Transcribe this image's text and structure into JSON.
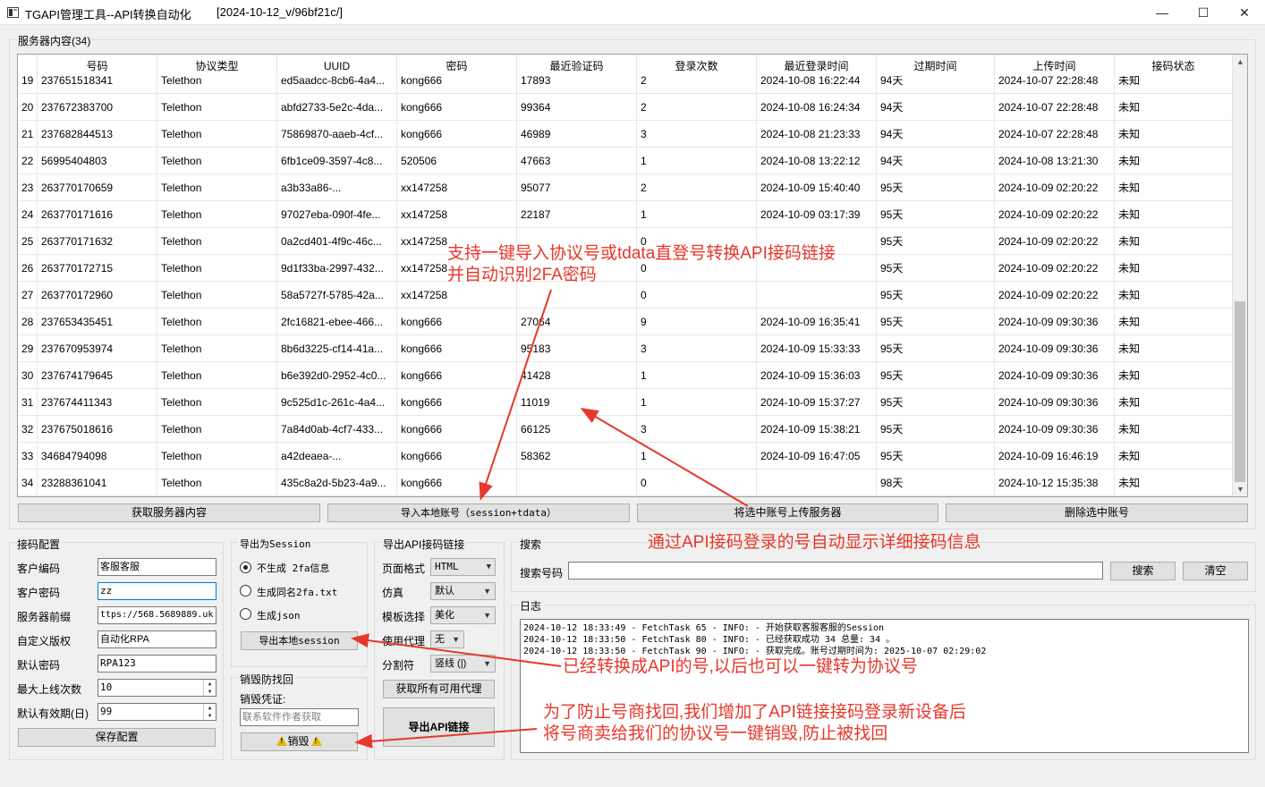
{
  "window": {
    "title": "TGAPI管理工具--API转换自动化",
    "version": "[2024-10-12_v/96bf21c/]",
    "minimize": "—",
    "maximize": "☐",
    "close": "✕"
  },
  "server_group": {
    "label": "服务器内容(34)"
  },
  "table": {
    "columns": [
      "号码",
      "协议类型",
      "UUID",
      "密码",
      "最近验证码",
      "登录次数",
      "最近登录时间",
      "过期时间",
      "上传时间",
      "接码状态"
    ],
    "rows": [
      {
        "n": "19",
        "phone": "237651518341",
        "proto": "Telethon",
        "uuid": "ed5aadcc-8cb6-4a4...",
        "pwd": "kong666",
        "code": "17893",
        "logins": "2",
        "last_login": "2024-10-08 16:22:44",
        "expire": "94天",
        "upload": "2024-10-07 22:28:48",
        "status": "未知"
      },
      {
        "n": "20",
        "phone": "237672383700",
        "proto": "Telethon",
        "uuid": "abfd2733-5e2c-4da...",
        "pwd": "kong666",
        "code": "99364",
        "logins": "2",
        "last_login": "2024-10-08 16:24:34",
        "expire": "94天",
        "upload": "2024-10-07 22:28:48",
        "status": "未知"
      },
      {
        "n": "21",
        "phone": "237682844513",
        "proto": "Telethon",
        "uuid": "75869870-aaeb-4cf...",
        "pwd": "kong666",
        "code": "46989",
        "logins": "3",
        "last_login": "2024-10-08 21:23:33",
        "expire": "94天",
        "upload": "2024-10-07 22:28:48",
        "status": "未知"
      },
      {
        "n": "22",
        "phone": "56995404803",
        "proto": "Telethon",
        "uuid": "6fb1ce09-3597-4c8...",
        "pwd": "520506",
        "code": "47663",
        "logins": "1",
        "last_login": "2024-10-08 13:22:12",
        "expire": "94天",
        "upload": "2024-10-08 13:21:30",
        "status": "未知"
      },
      {
        "n": "23",
        "phone": "263770170659",
        "proto": "Telethon",
        "uuid": "a3b33a86-...",
        "pwd": "xx147258",
        "code": "95077",
        "logins": "2",
        "last_login": "2024-10-09 15:40:40",
        "expire": "95天",
        "upload": "2024-10-09 02:20:22",
        "status": "未知"
      },
      {
        "n": "24",
        "phone": "263770171616",
        "proto": "Telethon",
        "uuid": "97027eba-090f-4fe...",
        "pwd": "xx147258",
        "code": "22187",
        "logins": "1",
        "last_login": "2024-10-09 03:17:39",
        "expire": "95天",
        "upload": "2024-10-09 02:20:22",
        "status": "未知"
      },
      {
        "n": "25",
        "phone": "263770171632",
        "proto": "Telethon",
        "uuid": "0a2cd401-4f9c-46c...",
        "pwd": "xx147258",
        "code": "",
        "logins": "0",
        "last_login": "",
        "expire": "95天",
        "upload": "2024-10-09 02:20:22",
        "status": "未知"
      },
      {
        "n": "26",
        "phone": "263770172715",
        "proto": "Telethon",
        "uuid": "9d1f33ba-2997-432...",
        "pwd": "xx147258",
        "code": "",
        "logins": "0",
        "last_login": "",
        "expire": "95天",
        "upload": "2024-10-09 02:20:22",
        "status": "未知"
      },
      {
        "n": "27",
        "phone": "263770172960",
        "proto": "Telethon",
        "uuid": "58a5727f-5785-42a...",
        "pwd": "xx147258",
        "code": "",
        "logins": "0",
        "last_login": "",
        "expire": "95天",
        "upload": "2024-10-09 02:20:22",
        "status": "未知"
      },
      {
        "n": "28",
        "phone": "237653435451",
        "proto": "Telethon",
        "uuid": "2fc16821-ebee-466...",
        "pwd": "kong666",
        "code": "27064",
        "logins": "9",
        "last_login": "2024-10-09 16:35:41",
        "expire": "95天",
        "upload": "2024-10-09 09:30:36",
        "status": "未知"
      },
      {
        "n": "29",
        "phone": "237670953974",
        "proto": "Telethon",
        "uuid": "8b6d3225-cf14-41a...",
        "pwd": "kong666",
        "code": "95183",
        "logins": "3",
        "last_login": "2024-10-09 15:33:33",
        "expire": "95天",
        "upload": "2024-10-09 09:30:36",
        "status": "未知"
      },
      {
        "n": "30",
        "phone": "237674179645",
        "proto": "Telethon",
        "uuid": "b6e392d0-2952-4c0...",
        "pwd": "kong666",
        "code": "41428",
        "logins": "1",
        "last_login": "2024-10-09 15:36:03",
        "expire": "95天",
        "upload": "2024-10-09 09:30:36",
        "status": "未知"
      },
      {
        "n": "31",
        "phone": "237674411343",
        "proto": "Telethon",
        "uuid": "9c525d1c-261c-4a4...",
        "pwd": "kong666",
        "code": "11019",
        "logins": "1",
        "last_login": "2024-10-09 15:37:27",
        "expire": "95天",
        "upload": "2024-10-09 09:30:36",
        "status": "未知"
      },
      {
        "n": "32",
        "phone": "237675018616",
        "proto": "Telethon",
        "uuid": "7a84d0ab-4cf7-433...",
        "pwd": "kong666",
        "code": "66125",
        "logins": "3",
        "last_login": "2024-10-09 15:38:21",
        "expire": "95天",
        "upload": "2024-10-09 09:30:36",
        "status": "未知"
      },
      {
        "n": "33",
        "phone": "34684794098",
        "proto": "Telethon",
        "uuid": "a42deaea-...",
        "pwd": "kong666",
        "code": "58362",
        "logins": "1",
        "last_login": "2024-10-09 16:47:05",
        "expire": "95天",
        "upload": "2024-10-09 16:46:19",
        "status": "未知"
      },
      {
        "n": "34",
        "phone": "23288361041",
        "proto": "Telethon",
        "uuid": "435c8a2d-5b23-4a9...",
        "pwd": "kong666",
        "code": "",
        "logins": "0",
        "last_login": "",
        "expire": "98天",
        "upload": "2024-10-12 15:35:38",
        "status": "未知"
      }
    ]
  },
  "actions": {
    "fetch": "获取服务器内容",
    "import": "导入本地账号（session+tdata）",
    "upload": "将选中账号上传服务器",
    "delete": "删除选中账号"
  },
  "config": {
    "label": "接码配置",
    "customer_id_label": "客户编码",
    "customer_id": "客服客服",
    "customer_pwd_label": "客户密码",
    "customer_pwd": "zz",
    "server_prefix_label": "服务器前缀",
    "server_prefix": "ttps://568.5689889.uk",
    "custom_copyright_label": "自定义版权",
    "custom_copyright": "自动化RPA",
    "default_pwd_label": "默认密码",
    "default_pwd": "RPA123",
    "max_logins_label": "最大上线次数",
    "max_logins": "10",
    "validity_label": "默认有效期(日)",
    "validity": "99",
    "save": "保存配置"
  },
  "session_export": {
    "label": "导出为Session",
    "opt1": "不生成 2fa信息",
    "opt2": "生成同名2fa.txt",
    "opt3": "生成json",
    "export_btn": "导出本地session"
  },
  "destroy": {
    "label": "销毁防找回",
    "credential_label": "销毁凭证:",
    "credential_placeholder": "联系软件作者获取",
    "destroy_btn": "销毁"
  },
  "api_export": {
    "label": "导出API接码链接",
    "page_format_label": "页面格式",
    "page_format": "HTML",
    "emulate_label": "仿真",
    "emulate": "默认",
    "template_label": "模板选择",
    "template": "美化",
    "proxy_label": "使用代理",
    "proxy": "无",
    "separator_label": "分割符",
    "separator": "竖线 (|)",
    "fetch_proxy_btn": "获取所有可用代理",
    "export_link_btn": "导出API链接"
  },
  "search": {
    "label": "搜索",
    "number_label": "搜索号码",
    "search_btn": "搜索",
    "clear_btn": "清空"
  },
  "log": {
    "label": "日志",
    "lines": [
      "2024-10-12 18:33:49 - FetchTask 65 - INFO: - 开始获取客服客服的Session",
      "2024-10-12 18:33:50 - FetchTask 80 - INFO: - 已经获取成功 34 总量: 34 。",
      "2024-10-12 18:33:50 - FetchTask 90 - INFO: - 获取完成。账号过期时间为: 2025-10-07 02:29:02"
    ]
  },
  "annotations": {
    "a1_line1": "支持一键导入协议号或tdata直登号转换API接码链接",
    "a1_line2": "并自动识别2FA密码",
    "a2": "通过API接码登录的号自动显示详细接码信息",
    "a3": "已经转换成API的号,以后也可以一键转为协议号",
    "a4_line1": "为了防止号商找回,我们增加了API链接接码登录新设备后",
    "a4_line2": "将号商卖给我们的协议号一键销毁,防止被找回",
    "color": "#e8372b"
  }
}
